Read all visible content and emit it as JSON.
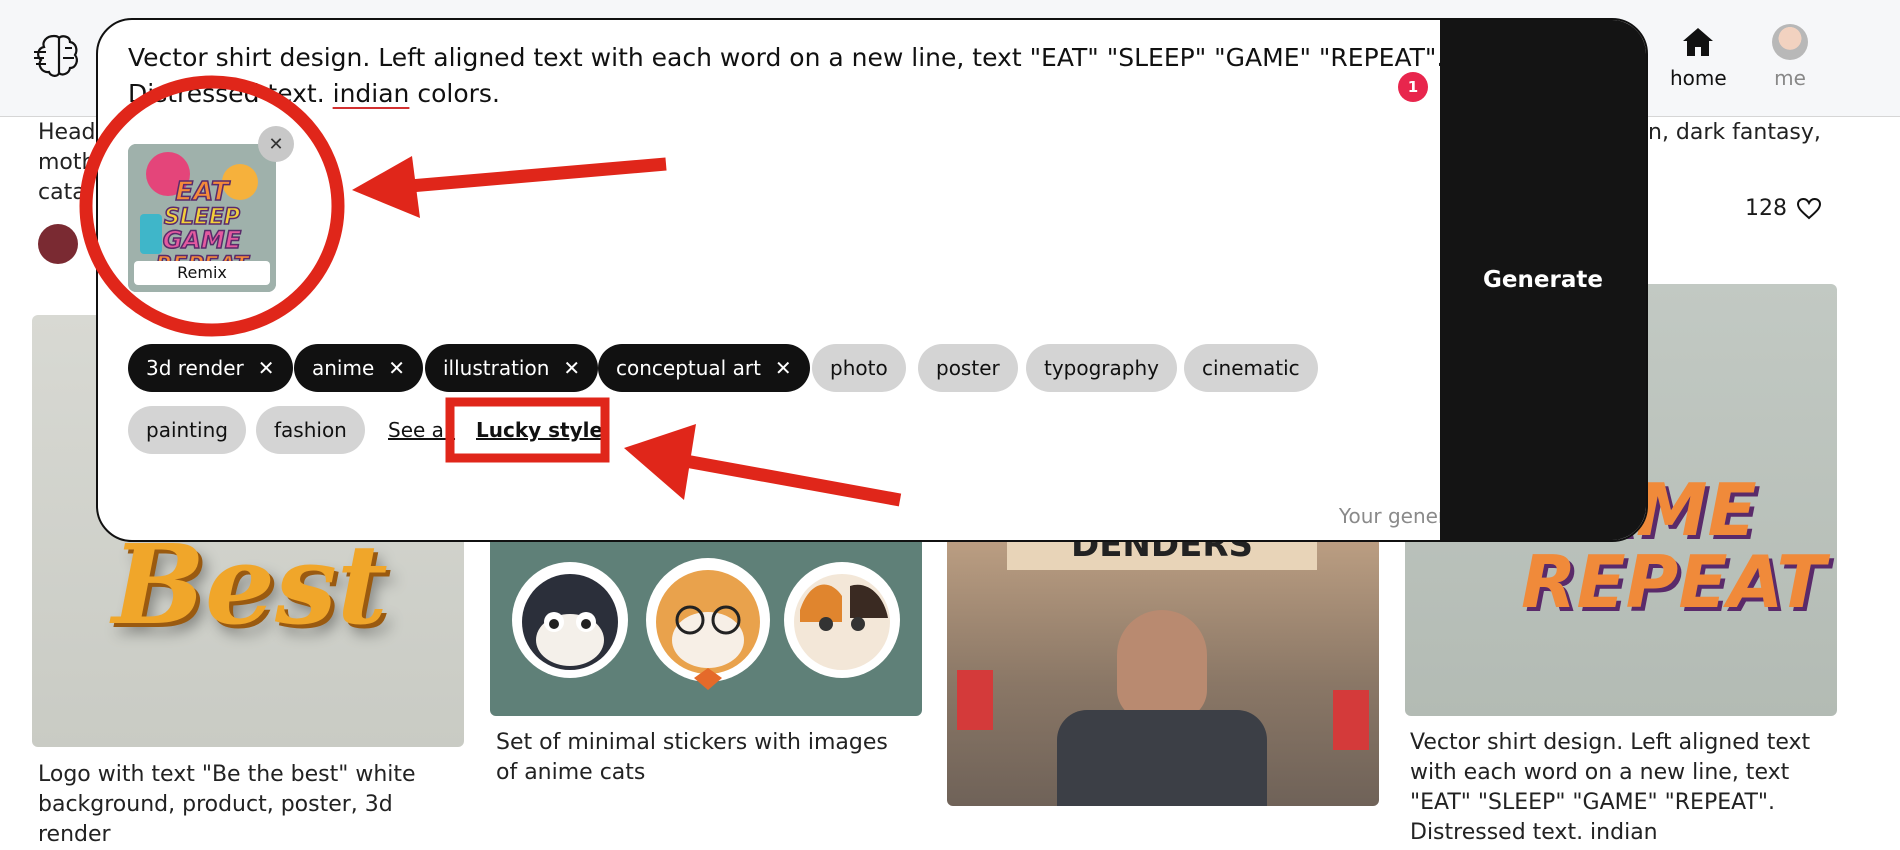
{
  "header": {
    "nav_home": "home",
    "nav_me": "me",
    "icons": {
      "logo": "brain-icon",
      "home": "home-icon"
    }
  },
  "background": {
    "top_left_text": "Headl\nmoth\ncata",
    "top_right_text": "n, dark fantasy,",
    "likes_count": "128",
    "cards": [
      {
        "caption": "Logo with text \"Be the best\" white background, product, poster, 3d render",
        "image_text": "Best"
      },
      {
        "caption": "Set of minimal stickers with images of anime cats"
      },
      {
        "caption": "",
        "image_text": "DENDERS"
      },
      {
        "caption": "Vector shirt design. Left aligned text with each word on a new line, text \"EAT\" \"SLEEP\" \"GAME\" \"REPEAT\". Distressed text. indian",
        "image_text": "EP\nGAME\nREPEAT"
      }
    ]
  },
  "modal": {
    "prompt_part1": "Vector shirt design. Left aligned text with each word on a new line, text \"EAT\" \"SLEEP\" \"GAME\" \"REPEAT\".",
    "prompt_part2": "Distressed text. ",
    "prompt_underlined": "indian",
    "prompt_part3": " colors.",
    "badge_count": "1",
    "remix_label": "Remix",
    "remix_image_text": [
      "EAT",
      "SLEEP",
      "GAME",
      "REPEAT"
    ],
    "tags": [
      {
        "label": "3d render",
        "selected": true
      },
      {
        "label": "anime",
        "selected": true
      },
      {
        "label": "illustration",
        "selected": true
      },
      {
        "label": "conceptual art",
        "selected": true
      },
      {
        "label": "photo",
        "selected": false
      },
      {
        "label": "poster",
        "selected": false
      },
      {
        "label": "typography",
        "selected": false
      },
      {
        "label": "cinematic",
        "selected": false
      },
      {
        "label": "painting",
        "selected": false
      },
      {
        "label": "fashion",
        "selected": false
      }
    ],
    "see_all_label": "See all",
    "lucky_style_label": "Lucky style",
    "public_note": "Your generation will be public",
    "generate_label": "Generate"
  },
  "colors": {
    "annotation_red": "#e0261a",
    "tag_selected": "#111111",
    "tag_unselected": "#d4d4d4",
    "badge": "#e8264d",
    "generate_bg": "#141414"
  }
}
